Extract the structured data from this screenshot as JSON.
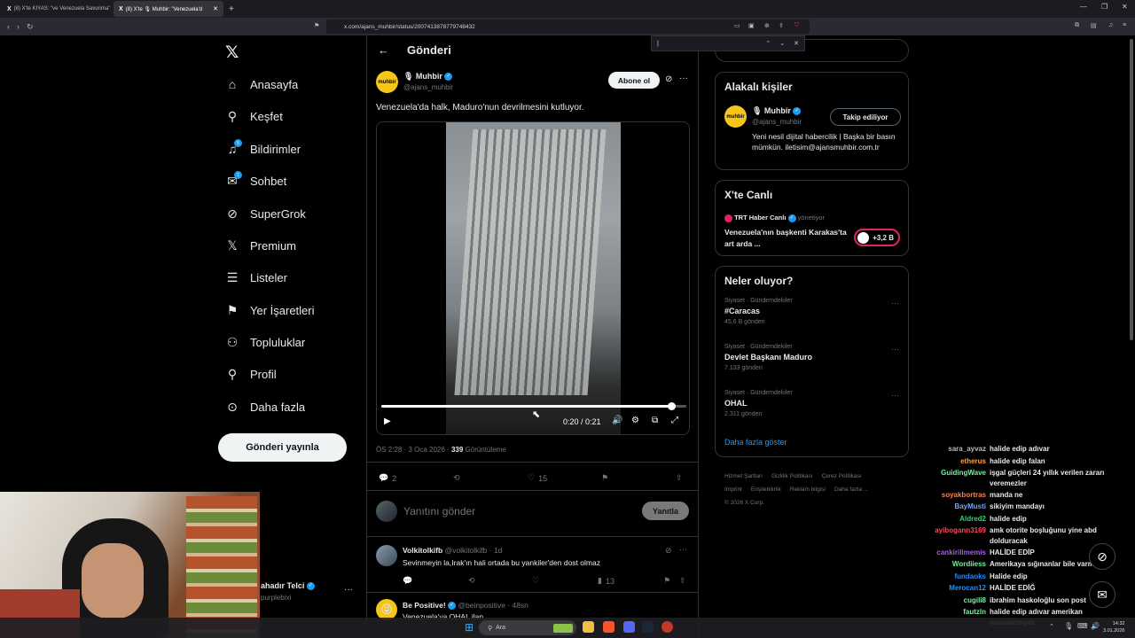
{
  "browser": {
    "tabs": [
      {
        "label": "(8) X'te KIYAS: \"ve Venezuela Savunma\"",
        "icon": "X"
      },
      {
        "label": "(8) X'te 🎙 Muhbir: \"Venezuela'd",
        "icon": "X"
      }
    ],
    "url": "x.com/ajans_muhbir/status/2007413878779748432",
    "find_value": "|"
  },
  "nav": {
    "items": [
      {
        "label": "Anasayfa",
        "icon": "home-icon",
        "glyph": "⌂"
      },
      {
        "label": "Keşfet",
        "icon": "search-icon",
        "glyph": "⚲"
      },
      {
        "label": "Bildirimler",
        "icon": "bell-icon",
        "glyph": "♫",
        "badge": "5"
      },
      {
        "label": "Sohbet",
        "icon": "mail-icon",
        "glyph": "✉",
        "badge": "1"
      },
      {
        "label": "SuperGrok",
        "icon": "grok-icon",
        "glyph": "⊘"
      },
      {
        "label": "Premium",
        "icon": "x-premium-icon",
        "glyph": "𝕏"
      },
      {
        "label": "Listeler",
        "icon": "list-icon",
        "glyph": "☰"
      },
      {
        "label": "Yer İşaretleri",
        "icon": "bookmark-icon",
        "glyph": "⚑"
      },
      {
        "label": "Topluluklar",
        "icon": "communities-icon",
        "glyph": "⚇"
      },
      {
        "label": "Profil",
        "icon": "profile-icon",
        "glyph": "⚲"
      },
      {
        "label": "Daha fazla",
        "icon": "more-circle-icon",
        "glyph": "⊙"
      }
    ],
    "post_button": "Gönderi yayınla",
    "account_name": "ahadır Telci",
    "account_handle": "purplebixi"
  },
  "post": {
    "header_title": "Gönderi",
    "author_name": "🎙 Muhbir",
    "author_handle": "@ajans_muhbir",
    "avatar_text": "muhbir",
    "subscribe_label": "Abone ol",
    "text": "Venezuela'da halk, Maduro'nun devrilmesini kutluyor.",
    "video_time": "0:20 / 0:21",
    "progress": 0.95,
    "meta_time": "ÖS 2:28 · 3 Oca 2026 · ",
    "views": "339",
    "views_label": " Görüntüleme",
    "replies": "2",
    "likes": "15",
    "reply_placeholder": "Yanıtını gönder",
    "reply_button": "Yanıtla"
  },
  "replies": [
    {
      "name": "Volkitolkifb",
      "handle": "@volkitolkifb · 1d",
      "text": "Sevinmeyin la,Irak'ın hali ortada bu yankiler'den dost olmaz",
      "views": "13"
    },
    {
      "name": "Be Positive!",
      "handle": "@beinpositive · 48sn",
      "text": "Venezuela'ya OHAL ilan"
    }
  ],
  "related": {
    "title": "Alakalı kişiler",
    "name": "🎙 Muhbir",
    "handle": "@ajans_muhbir",
    "follow_label": "Takip ediliyor",
    "bio": "Yeni nesil dijital habercilik | Başka bir basın mümkün. iletisim@ajansmuhbir.com.tr"
  },
  "live": {
    "title": "X'te Canlı",
    "host": "TRT Haber Canlı",
    "host_role": "yönetiyor",
    "headline": "Venezuela'nın başkenti Karakas'ta art arda ...",
    "listeners": "+3,2 B"
  },
  "trends": {
    "title": "Neler oluyor?",
    "items": [
      {
        "category": "Siyaset · Gündemdekiler",
        "name": "#Caracas",
        "count": "45,6 B gönderi"
      },
      {
        "category": "Siyaset · Gündemdekiler",
        "name": "Devlet Başkanı Maduro",
        "count": "7.133 gönderi"
      },
      {
        "category": "Siyaset · Gündemdekiler",
        "name": "OHAL",
        "count": "2.311 gönderi"
      }
    ],
    "show_more": "Daha fazla göster"
  },
  "footer": {
    "links": [
      "Hizmet Şartları",
      "Gizlilik Politikası",
      "Çerez Politikası",
      "Imprint",
      "Erişilebilirlik",
      "Reklam bilgisi",
      "Daha fazla ..."
    ],
    "copyright": "© 2026 X Corp."
  },
  "chat": [
    {
      "user": "sara_ayvaz",
      "color": "#b8b8b8",
      "msg": "halide edip adıvar"
    },
    {
      "user": "etherus",
      "color": "#ff9f43",
      "msg": "halide edip falan"
    },
    {
      "user": "GuidingWave",
      "color": "#7bed9f",
      "msg": "işgal güçleri 24 yıllık verilen zararı",
      "cont": "veremezler"
    },
    {
      "user": "soyakbortras",
      "color": "#ff7f50",
      "msg": "manda ne"
    },
    {
      "user": "BayMusti",
      "color": "#70a1ff",
      "msg": "sikiyim mandayı"
    },
    {
      "user": "Aldred2",
      "color": "#2ed573",
      "msg": "halide edip"
    },
    {
      "user": "ayibogann3169",
      "color": "#ff4757",
      "msg": "amk otorite boşluğunu yine abd",
      "cont": "dolduracak"
    },
    {
      "user": "cankirilimemis",
      "color": "#a55eea",
      "msg": "HALİDE EDİP"
    },
    {
      "user": "Wordiiess",
      "color": "#7bed9f",
      "msg": "Amerikaya sığınanlar bile varmış"
    },
    {
      "user": "fundaoks",
      "color": "#1e90ff",
      "msg": "Halide edip"
    },
    {
      "user": "Merocan12",
      "color": "#1e90ff",
      "msg": "HALİDE EDİĞ"
    },
    {
      "user": "cugili8",
      "color": "#7bed9f",
      "msg": "ibrahim haskoloğlu son post"
    },
    {
      "user": "fautzln",
      "color": "#7bed9f",
      "msg": "halide edip adıvar amerikan",
      "cont": "mandacısıydı"
    }
  ],
  "taskbar": {
    "search": "Ara",
    "time": "14:32",
    "date": "3.01.2026"
  }
}
